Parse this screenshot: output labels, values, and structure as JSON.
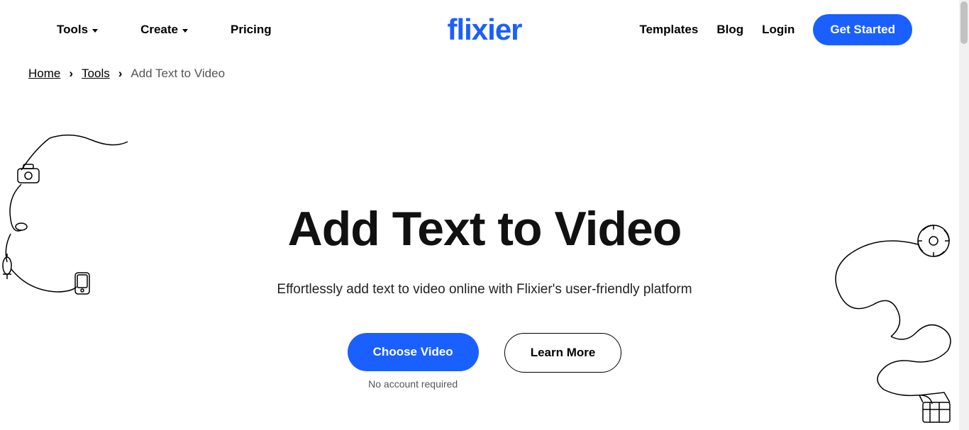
{
  "nav": {
    "left": [
      {
        "label": "Tools",
        "hasDropdown": true
      },
      {
        "label": "Create",
        "hasDropdown": true
      },
      {
        "label": "Pricing",
        "hasDropdown": false
      }
    ],
    "right": [
      {
        "label": "Templates"
      },
      {
        "label": "Blog"
      },
      {
        "label": "Login"
      }
    ],
    "cta": "Get Started"
  },
  "logo": "flixier",
  "breadcrumb": {
    "items": [
      {
        "label": "Home",
        "link": true
      },
      {
        "label": "Tools",
        "link": true
      },
      {
        "label": "Add Text to Video",
        "link": false
      }
    ]
  },
  "hero": {
    "title": "Add Text to Video",
    "subtitle": "Effortlessly add text to video online with Flixier's user-friendly platform",
    "primaryButton": "Choose Video",
    "secondaryButton": "Learn More",
    "note": "No account required"
  }
}
